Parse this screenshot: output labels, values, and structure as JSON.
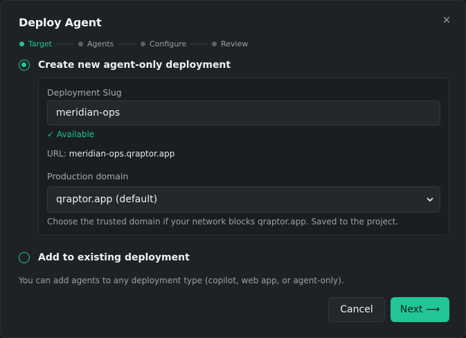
{
  "dialog": {
    "title": "Deploy Agent",
    "close_glyph": "✕"
  },
  "stepper": {
    "steps": [
      {
        "label": "Target",
        "active": true
      },
      {
        "label": "Agents",
        "active": false
      },
      {
        "label": "Configure",
        "active": false
      },
      {
        "label": "Review",
        "active": false
      }
    ]
  },
  "options": {
    "new": {
      "label": "Create new agent-only deployment",
      "selected": true
    },
    "existing": {
      "label": "Add to existing deployment",
      "selected": false
    }
  },
  "panel": {
    "slug_label": "Deployment Slug",
    "slug_value": "meridian-ops",
    "available_text": "✓ Available",
    "url_prefix": "URL:",
    "url_value": "meridian-ops.qraptor.app",
    "domain_label": "Production domain",
    "domain_selected": "qraptor.app (default)",
    "domain_hint": "Choose the trusted domain if your network blocks qraptor.app. Saved to the project."
  },
  "footnote": "You can add agents to any deployment type (copilot, web app, or agent-only).",
  "buttons": {
    "cancel": "Cancel",
    "next": "Next ⟶"
  },
  "colors": {
    "accent": "#22c596",
    "background": "#1e2226",
    "panel": "#1a1d21"
  },
  "icons": {
    "close": "close-icon",
    "select": "chevron-down-icon",
    "arrow": "arrow-right-icon"
  }
}
